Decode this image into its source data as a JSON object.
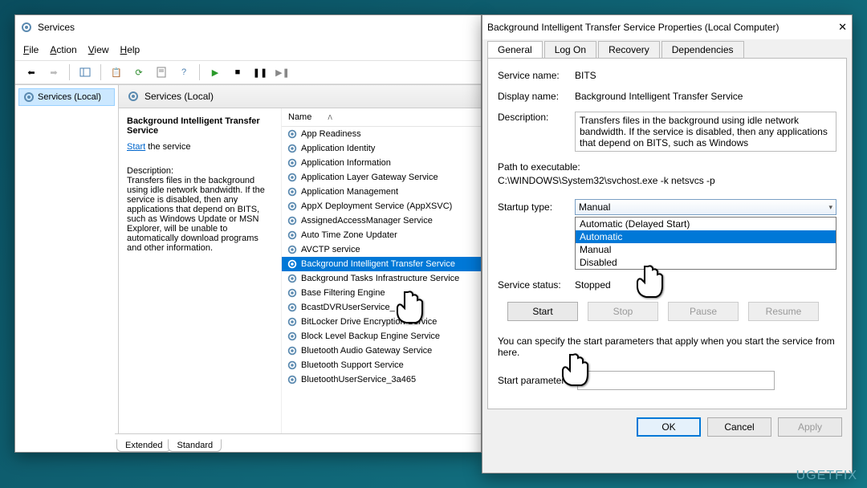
{
  "services_window": {
    "title": "Services",
    "menu": {
      "file": "File",
      "action": "Action",
      "view": "View",
      "help": "Help"
    },
    "tree_item": "Services (Local)",
    "pane_header": "Services (Local)",
    "selected_service_name": "Background Intelligent Transfer Service",
    "start_link": "Start",
    "start_suffix": " the service",
    "desc_label": "Description:",
    "desc_text": "Transfers files in the background using idle network bandwidth. If the service is disabled, then any applications that depend on BITS, such as Windows Update or MSN Explorer, will be unable to automatically download programs and other information.",
    "col_name": "Name",
    "tabs": {
      "extended": "Extended",
      "standard": "Standard"
    },
    "list": [
      "App Readiness",
      "Application Identity",
      "Application Information",
      "Application Layer Gateway Service",
      "Application Management",
      "AppX Deployment Service (AppXSVC)",
      "AssignedAccessManager Service",
      "Auto Time Zone Updater",
      "AVCTP service",
      "Background Intelligent Transfer Service",
      "Background Tasks Infrastructure Service",
      "Base Filtering Engine",
      "BcastDVRUserService_",
      "BitLocker Drive Encryption Service",
      "Block Level Backup Engine Service",
      "Bluetooth Audio Gateway Service",
      "Bluetooth Support Service",
      "BluetoothUserService_3a465"
    ],
    "selected_index": 9
  },
  "props_dialog": {
    "title": "Background Intelligent Transfer Service Properties (Local Computer)",
    "tabs": [
      "General",
      "Log On",
      "Recovery",
      "Dependencies"
    ],
    "active_tab": 0,
    "labels": {
      "service_name": "Service name:",
      "display_name": "Display name:",
      "description": "Description:",
      "path": "Path to executable:",
      "startup": "Startup type:",
      "status": "Service status:",
      "params": "Start parameters:",
      "hint": "You can specify the start parameters that apply when you start the service from here."
    },
    "values": {
      "service_name": "BITS",
      "display_name": "Background Intelligent Transfer Service",
      "description": "Transfers files in the background using idle network bandwidth. If the service is disabled, then any applications that depend on BITS, such as Windows",
      "path": "C:\\WINDOWS\\System32\\svchost.exe -k netsvcs -p",
      "startup_selected": "Manual",
      "status": "Stopped"
    },
    "startup_options": [
      "Automatic (Delayed Start)",
      "Automatic",
      "Manual",
      "Disabled"
    ],
    "startup_highlight": 1,
    "buttons": {
      "start": "Start",
      "stop": "Stop",
      "pause": "Pause",
      "resume": "Resume"
    },
    "dlg_buttons": {
      "ok": "OK",
      "cancel": "Cancel",
      "apply": "Apply"
    }
  },
  "watermark": "UGETFIX"
}
